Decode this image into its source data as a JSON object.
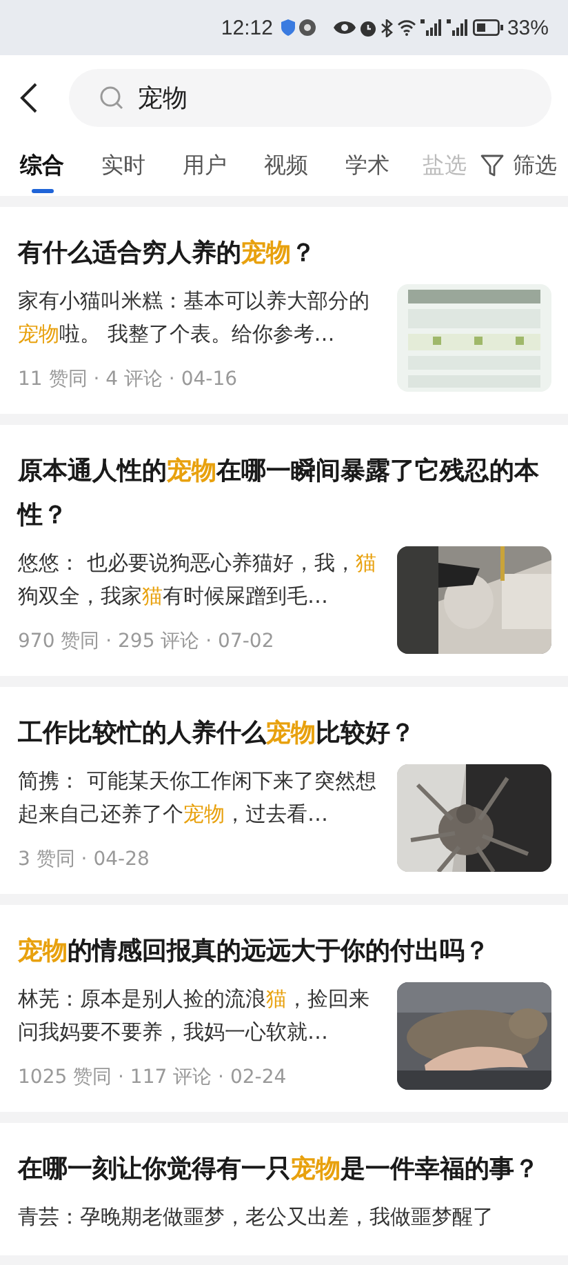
{
  "status_bar": {
    "time": "12:12",
    "battery": "33%"
  },
  "search": {
    "value": "宠物"
  },
  "tabs": [
    {
      "label": "综合",
      "selected": true
    },
    {
      "label": "实时",
      "selected": false
    },
    {
      "label": "用户",
      "selected": false
    },
    {
      "label": "视频",
      "selected": false
    },
    {
      "label": "学术",
      "selected": false
    },
    {
      "label": "盐选",
      "selected": false
    }
  ],
  "filter": {
    "label": "筛选"
  },
  "results": [
    {
      "title": "有什么适合穷人养的**宠物**？",
      "snippet": "家有小猫叫米糕：基本可以养大部分的**宠物**啦。 我整了个表。给你参考…",
      "meta": "11 赞同 · 4 评论 · 04-16"
    },
    {
      "title": "原本通人性的**宠物**在哪一瞬间暴露了它残忍的本性？",
      "snippet": "悠悠： 也必要说狗恶心养猫好，我，**猫**狗双全，我家**猫**有时候屎蹭到毛…",
      "meta": "970 赞同 · 295 评论 · 07-02"
    },
    {
      "title": "工作比较忙的人养什么**宠物**比较好？",
      "snippet": "简携： 可能某天你工作闲下来了突然想起来自己还养了个**宠物**，过去看…",
      "meta": "3 赞同 · 04-28"
    },
    {
      "title": "**宠物**的情感回报真的远远大于你的付出吗？",
      "snippet": "林芜：原本是别人捡的流浪**猫**，捡回来问我妈要不要养，我妈一心软就…",
      "meta": "1025 赞同 · 117 评论 · 02-24"
    },
    {
      "title": "在哪一刻让你觉得有一只**宠物**是一件幸福的事？",
      "snippet": "青芸：孕晚期老做噩梦，老公又出差，我做噩梦醒了"
    }
  ]
}
